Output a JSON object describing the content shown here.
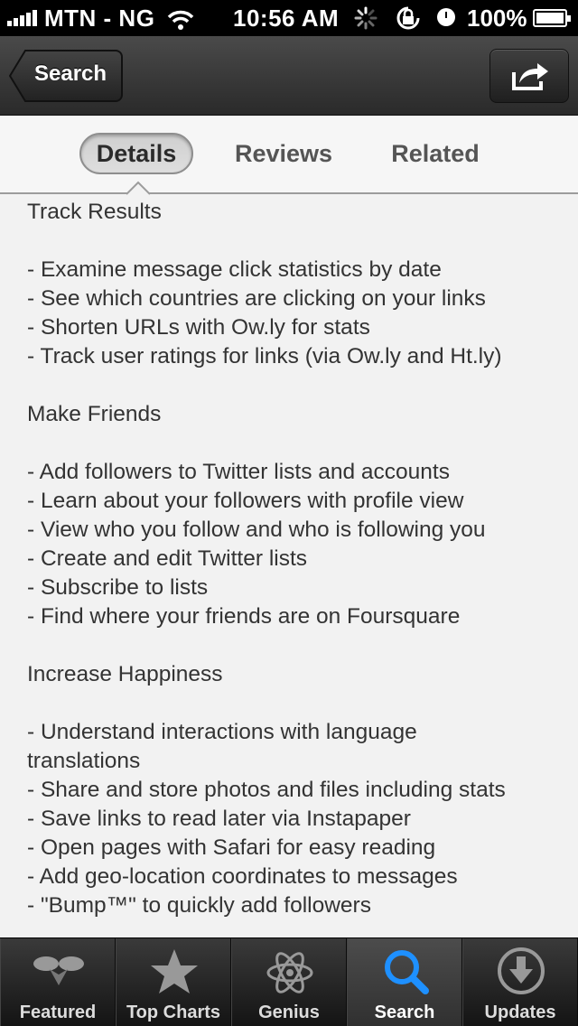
{
  "status_bar": {
    "carrier": "MTN - NG",
    "time": "10:56 AM",
    "battery": "100%"
  },
  "nav": {
    "back_label": "Search",
    "share_icon": "share-icon"
  },
  "segments": {
    "details": "Details",
    "reviews": "Reviews",
    "related": "Related"
  },
  "content": {
    "lines": [
      "Track Results",
      "",
      "- Examine message click statistics by date",
      "- See which countries are clicking on your links",
      "- Shorten URLs with Ow.ly for stats",
      "- Track user ratings for links (via Ow.ly and Ht.ly)",
      "",
      "Make Friends",
      "",
      "- Add followers to Twitter lists and accounts",
      "- Learn about your followers with profile view",
      "- View who you follow and who is following you",
      "- Create and edit Twitter lists",
      "- Subscribe to lists",
      "- Find where your friends are on Foursquare",
      "",
      "Increase Happiness",
      "",
      "- Understand interactions with language",
      "translations",
      "- Share and store photos and files including stats",
      "- Save links to read later via Instapaper",
      "- Open pages with Safari for easy reading",
      "- Add geo-location coordinates to messages",
      "- \"Bump™\" to quickly add followers"
    ]
  },
  "tabs": {
    "featured": "Featured",
    "top_charts": "Top Charts",
    "genius": "Genius",
    "search": "Search",
    "updates": "Updates"
  },
  "colors": {
    "active_tab_icon": "#1e90ff",
    "nav_background": "#333333",
    "content_background": "#f2f2f2"
  }
}
